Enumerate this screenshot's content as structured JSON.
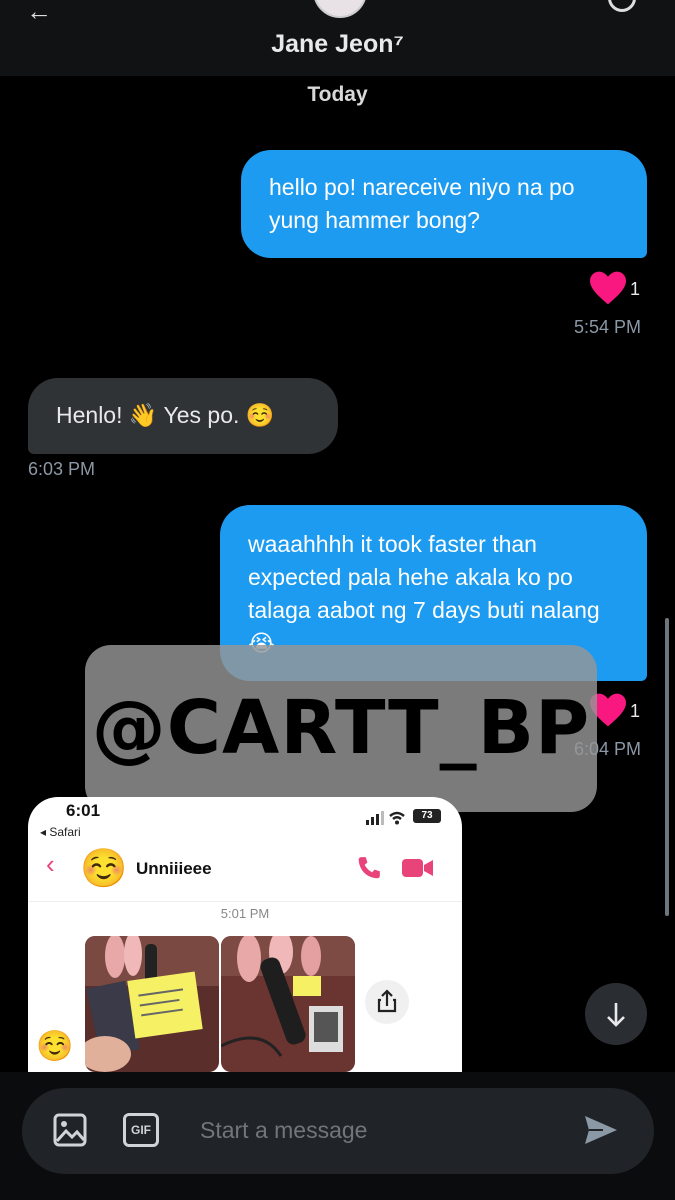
{
  "header": {
    "contact_name": "Jane Jeon⁷"
  },
  "date_separator": "Today",
  "messages": [
    {
      "direction": "sent",
      "text": "hello po! nareceive niyo na po yung hammer bong?",
      "reaction_count": "1",
      "time": "5:54 PM"
    },
    {
      "direction": "received",
      "text": "Henlo! 👋 Yes po. ☺️",
      "time": "6:03 PM"
    },
    {
      "direction": "sent",
      "text": "waaahhhh it took faster than expected pala hehe akala ko po talaga aabot ng 7 days buti nalang😭",
      "reaction_count": "1",
      "time": "6:04 PM"
    }
  ],
  "watermark": "@CARTT_BP",
  "embedded_screenshot": {
    "status_time": "6:01",
    "back_app": "◂ Safari",
    "battery": "73",
    "contact_name": "Unniiieee",
    "avatar_emoji": "☺️",
    "message_time": "5:01 PM",
    "reaction_emoji": "☺️"
  },
  "composer": {
    "placeholder": "Start a message",
    "gif_label": "GIF"
  },
  "colors": {
    "sent_bubble": "#1d9bf0",
    "received_bubble": "#2f3336",
    "heart": "#f91880",
    "accent_pink": "#e9447a"
  }
}
